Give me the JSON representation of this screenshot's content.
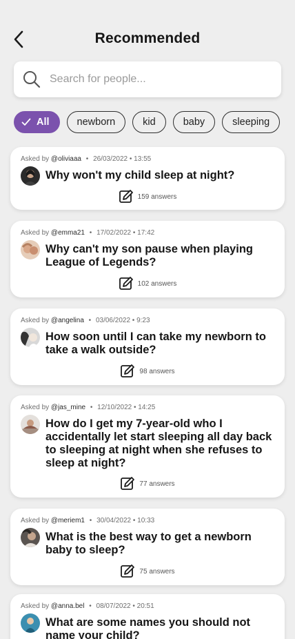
{
  "header": {
    "title": "Recommended",
    "back_icon": "chevron-left-icon"
  },
  "search": {
    "placeholder": "Search for people...",
    "value": "",
    "icon": "search-icon"
  },
  "filters": [
    {
      "label": "All",
      "active": true
    },
    {
      "label": "newborn",
      "active": false
    },
    {
      "label": "kid",
      "active": false
    },
    {
      "label": "baby",
      "active": false
    },
    {
      "label": "sleeping",
      "active": false
    }
  ],
  "questions": [
    {
      "asked_by_label": "Asked by",
      "handle": "@oliviaaa",
      "datetime": "26/03/2022 • 13:55",
      "question": "Why won't my child sleep at night?",
      "answers": "159 answers"
    },
    {
      "asked_by_label": "Asked by",
      "handle": "@emma21",
      "datetime": "17/02/2022 • 17:42",
      "question": "Why can't my son pause when playing League of Legends?",
      "answers": "102 answers"
    },
    {
      "asked_by_label": "Asked by",
      "handle": "@angelina",
      "datetime": "03/06/2022 • 9:23",
      "question": "How soon until I can take my newborn to take a walk outside?",
      "answers": "98 answers"
    },
    {
      "asked_by_label": "Asked by",
      "handle": "@jas_mine",
      "datetime": "12/10/2022 • 14:25",
      "question": "How do I get my 7-year-old who I accidentally let start sleeping all day back to sleeping at night when she refuses to sleep at night?",
      "answers": "77 answers"
    },
    {
      "asked_by_label": "Asked by",
      "handle": "@meriem1",
      "datetime": "30/04/2022 • 10:33",
      "question": "What is the best way to get a newborn baby to sleep?",
      "answers": "75 answers"
    },
    {
      "asked_by_label": "Asked by",
      "handle": "@anna.bel",
      "datetime": "08/07/2022 • 20:51",
      "question": "What are some names you should not name your child?",
      "answers": ""
    }
  ],
  "colors": {
    "accent": "#7b52ad",
    "background": "#eeeeee",
    "card": "#ffffff"
  }
}
